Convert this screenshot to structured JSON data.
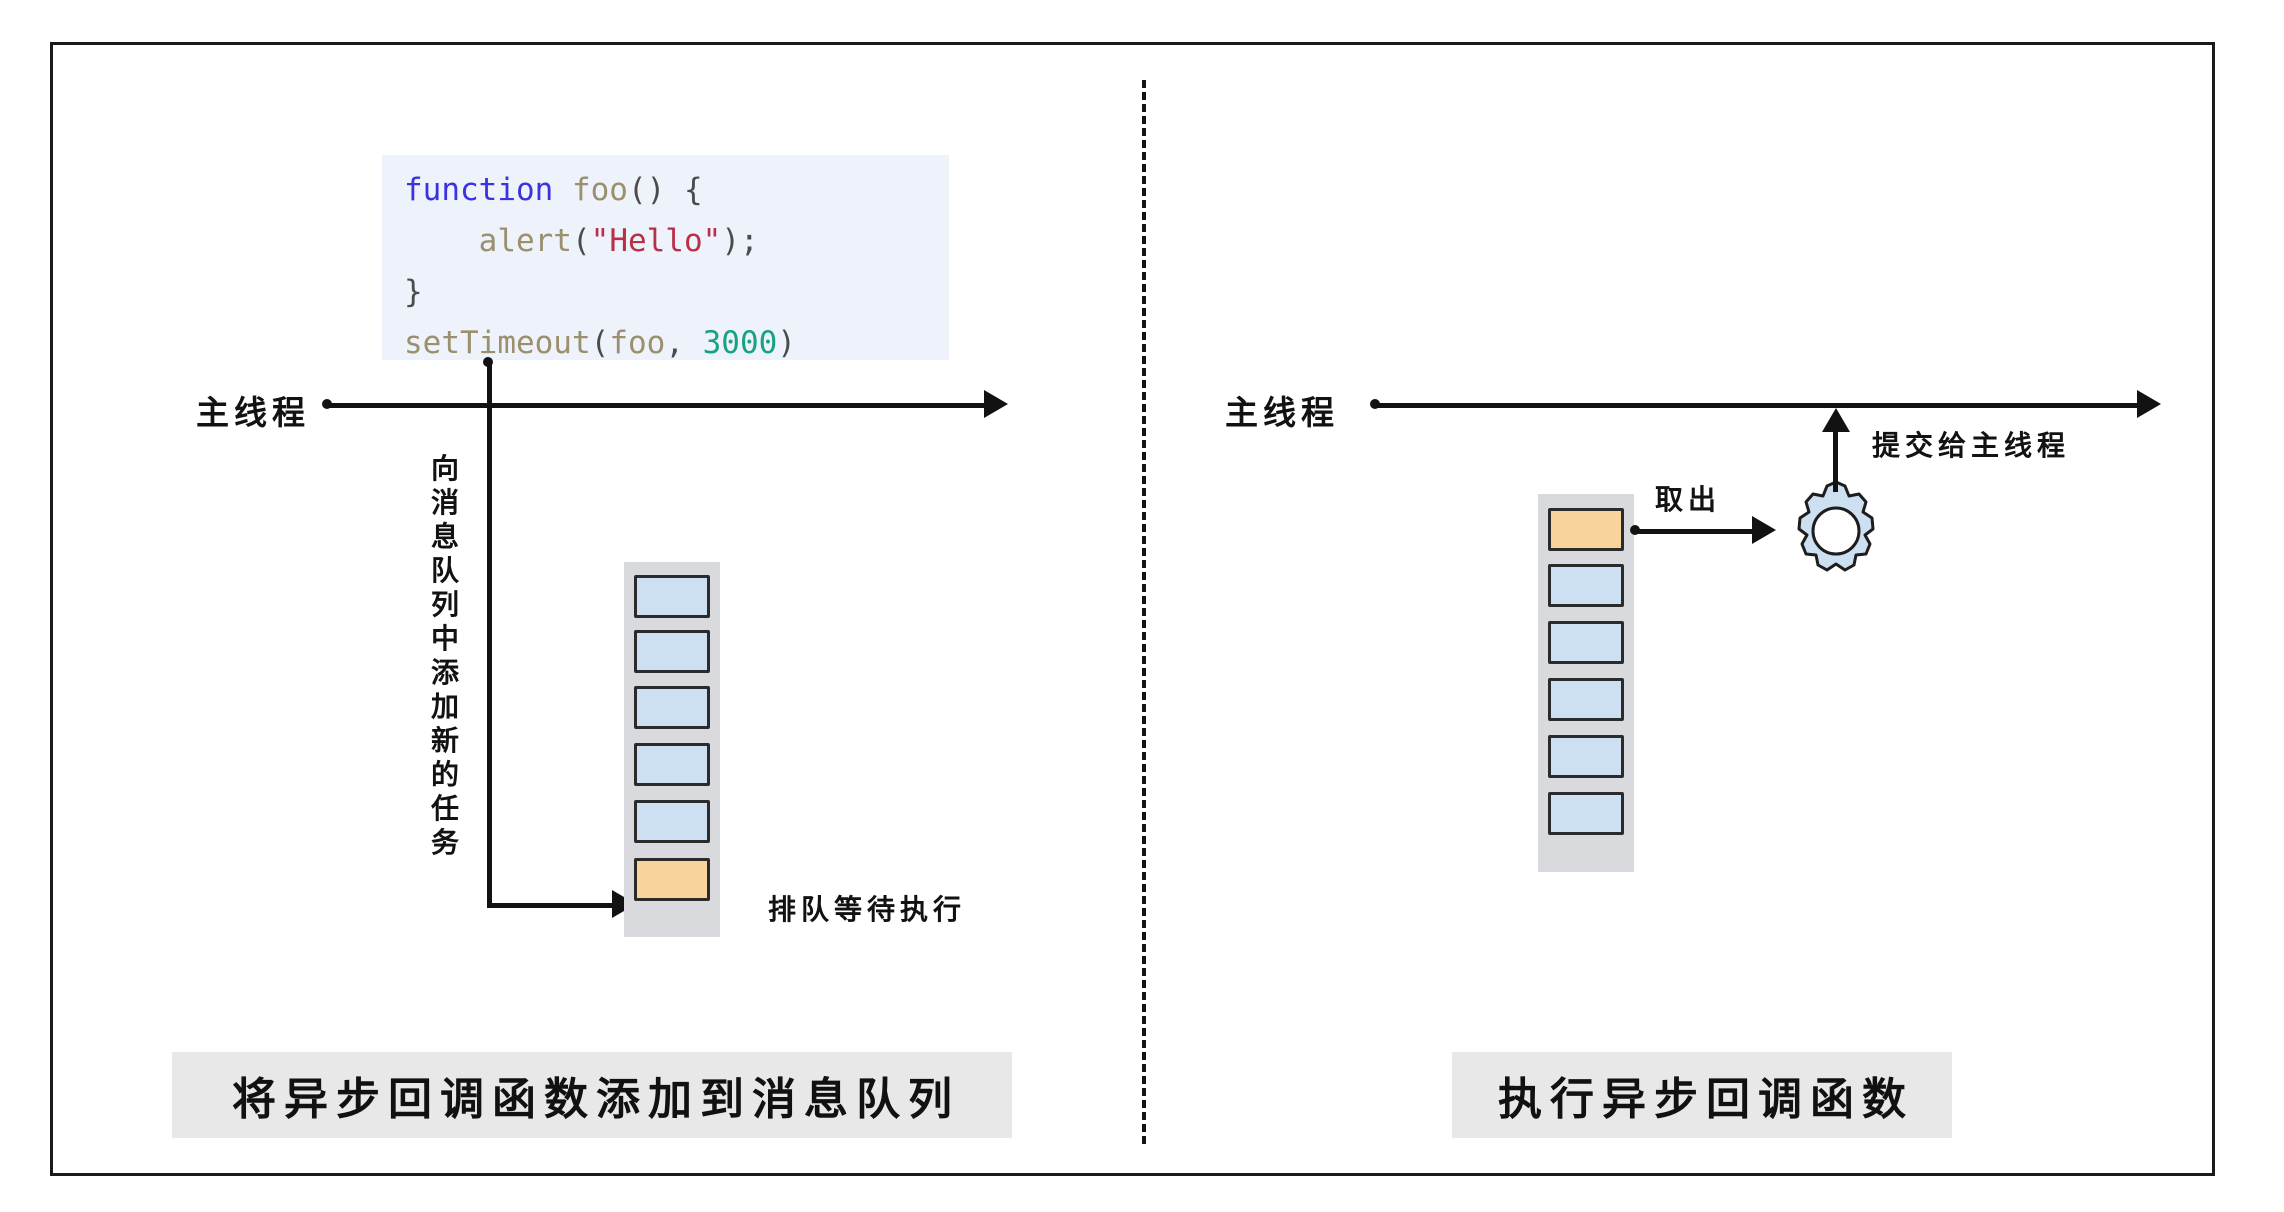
{
  "diagram": {
    "title": "JavaScript Event Loop / Message Queue Diagram",
    "colors": {
      "frame_border": "#1a1a1a",
      "code_background": "#eef2fb",
      "keyword_blue": "#3a33e0",
      "string_red": "#b83048",
      "number_green": "#18a37e",
      "identifier_tan": "#9c8f6e",
      "queue_container": "#d9dade",
      "task_blue": "#cde0f2",
      "task_orange": "#f9d49a",
      "task_border": "#2b2b2b",
      "caption_background": "#e8e8e8",
      "ink": "#121212"
    }
  },
  "code": {
    "line1": {
      "keyword": "function",
      "space": " ",
      "name": "foo",
      "punct": "() {"
    },
    "line2": {
      "indent": "    ",
      "name": "alert",
      "open": "(",
      "string": "\"Hello\"",
      "close": ");"
    },
    "line3": {
      "punct": "}"
    },
    "line4": {
      "name": "setTimeout",
      "open": "(",
      "arg": "foo",
      "comma": ", ",
      "number": "3000",
      "close": ")"
    },
    "full_text": "function foo() {\n    alert(\"Hello\");\n}\nsetTimeout(foo, 3000)"
  },
  "left_panel": {
    "thread_label": "主线程",
    "vertical_note": "向消息队列中添加新的任务",
    "queue_note": "排队等待执行",
    "caption": "将异步回调函数添加到消息队列",
    "queue": {
      "slots": [
        {
          "index": 0,
          "state": "blue"
        },
        {
          "index": 1,
          "state": "blue"
        },
        {
          "index": 2,
          "state": "blue"
        },
        {
          "index": 3,
          "state": "blue"
        },
        {
          "index": 4,
          "state": "blue"
        },
        {
          "index": 5,
          "state": "orange"
        }
      ],
      "count": 6,
      "highlight_index": 5,
      "highlight_position": "bottom"
    }
  },
  "right_panel": {
    "thread_label": "主线程",
    "dequeue_label": "取出",
    "submit_label": "提交给主线程",
    "caption": "执行异步回调函数",
    "gear": {
      "teeth": 10,
      "name": "gear-icon"
    },
    "queue": {
      "slots": [
        {
          "index": 0,
          "state": "orange"
        },
        {
          "index": 1,
          "state": "blue"
        },
        {
          "index": 2,
          "state": "blue"
        },
        {
          "index": 3,
          "state": "blue"
        },
        {
          "index": 4,
          "state": "blue"
        },
        {
          "index": 5,
          "state": "blue"
        }
      ],
      "count": 6,
      "highlight_index": 0,
      "highlight_position": "top"
    }
  }
}
